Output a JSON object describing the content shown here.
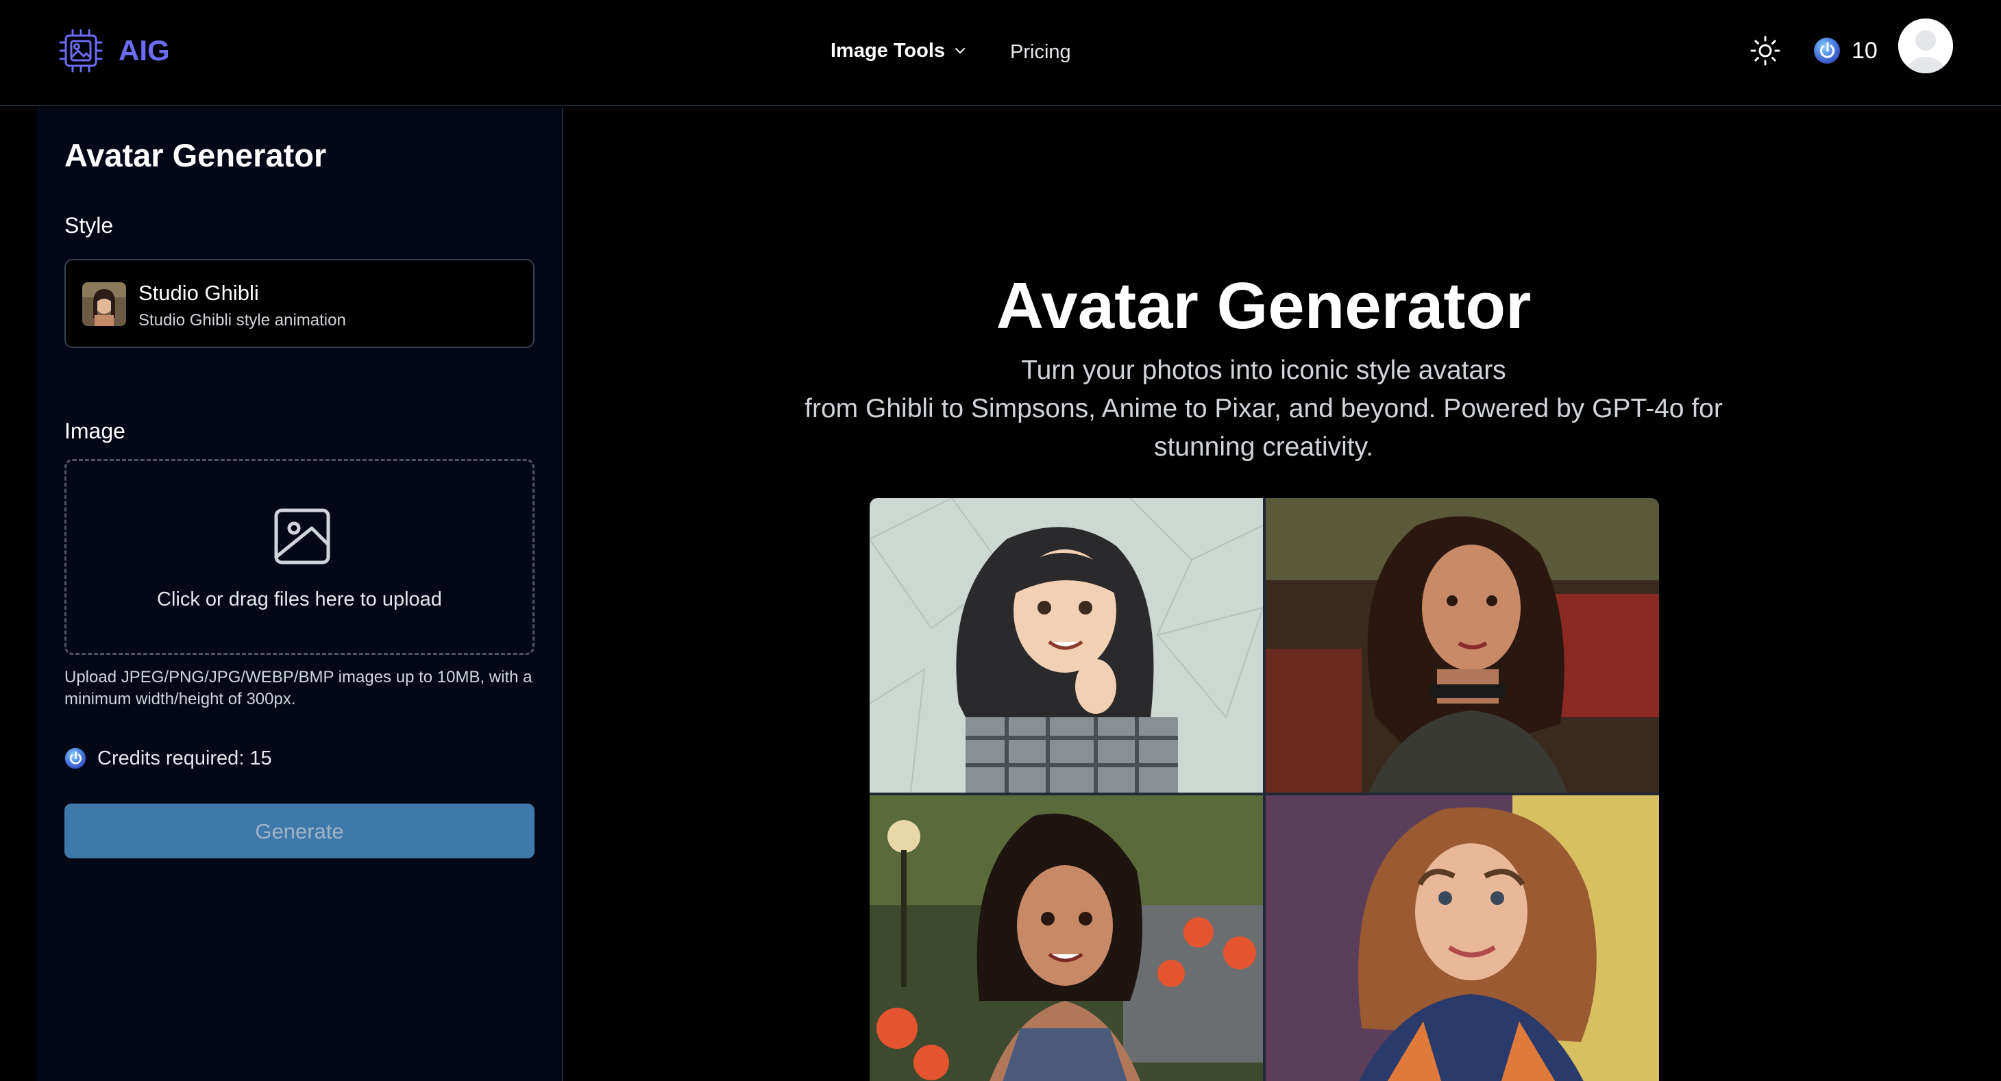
{
  "header": {
    "logo_text": "AIG",
    "nav": {
      "image_tools_label": "Image Tools",
      "pricing_label": "Pricing"
    },
    "credits": "10"
  },
  "sidebar": {
    "title": "Avatar Generator",
    "style_label": "Style",
    "style": {
      "name": "Studio Ghibli",
      "description": "Studio Ghibli style animation"
    },
    "image_label": "Image",
    "upload_text": "Click or drag files here to upload",
    "upload_hint": "Upload JPEG/PNG/JPG/WEBP/BMP images up to 10MB, with a minimum width/height of 300px.",
    "credits_required": "Credits required: 15",
    "generate_label": "Generate"
  },
  "main": {
    "title": "Avatar Generator",
    "subtitle_line1": "Turn your photos into iconic style avatars",
    "subtitle_line2": "from Ghibli to Simpsons, Anime to Pixar, and beyond. Powered by GPT-4o for stunning creativity."
  },
  "gallery": {
    "count": 4
  },
  "colors": {
    "accent": "#6d6cf6",
    "generate_button": "#3f79aa",
    "sidebar_bg": "#030816",
    "page_bg": "#000000"
  },
  "icons": [
    "logo-chip-icon",
    "chevron-down-icon",
    "sun-icon",
    "credit-coin-icon",
    "user-avatar-icon",
    "image-upload-icon"
  ]
}
